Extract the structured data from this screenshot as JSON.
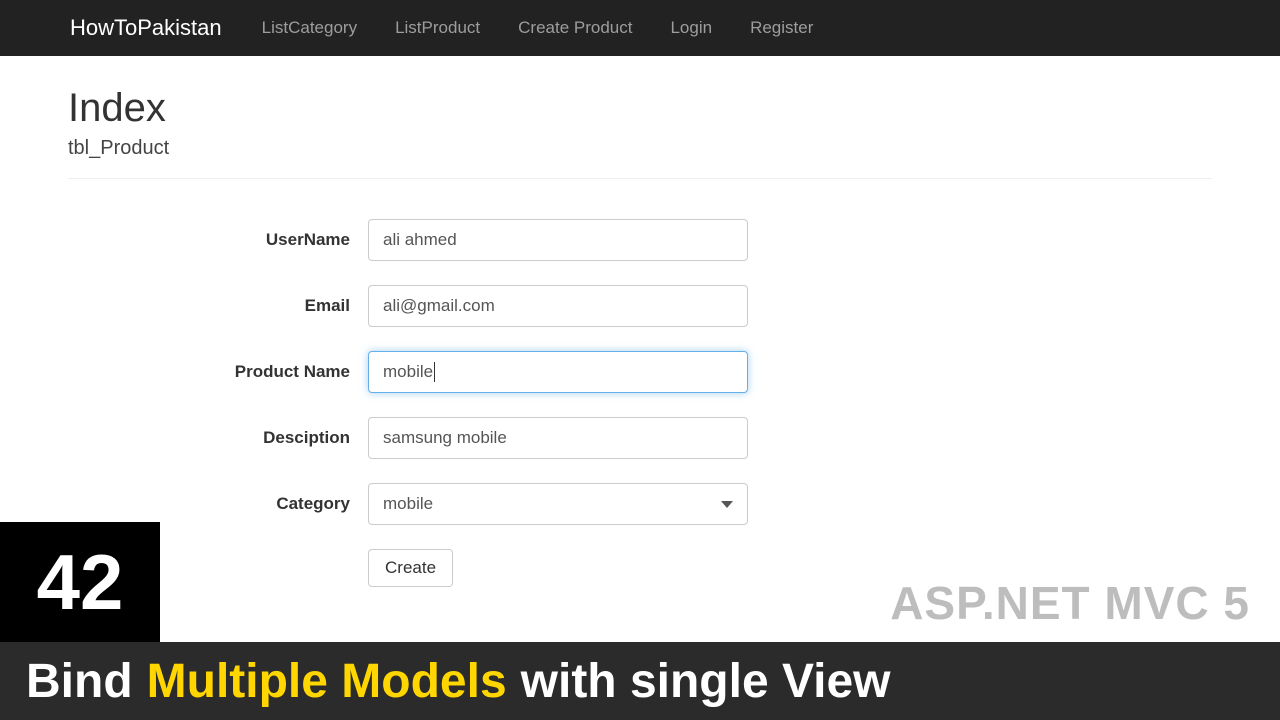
{
  "navbar": {
    "brand": "HowToPakistan",
    "items": [
      "ListCategory",
      "ListProduct",
      "Create Product",
      "Login",
      "Register"
    ]
  },
  "page": {
    "title": "Index",
    "subtitle": "tbl_Product"
  },
  "form": {
    "username": {
      "label": "UserName",
      "value": "ali ahmed"
    },
    "email": {
      "label": "Email",
      "value": "ali@gmail.com"
    },
    "productname": {
      "label": "Product Name",
      "value": "mobile"
    },
    "description": {
      "label": "Desciption",
      "value": "samsung mobile"
    },
    "category": {
      "label": "Category",
      "value": "mobile"
    },
    "submit": "Create"
  },
  "overlay": {
    "number": "42",
    "framework": "ASP.NET MVC 5",
    "title_pre": "Bind",
    "title_hl": "Multiple Models",
    "title_post": "with single View"
  }
}
